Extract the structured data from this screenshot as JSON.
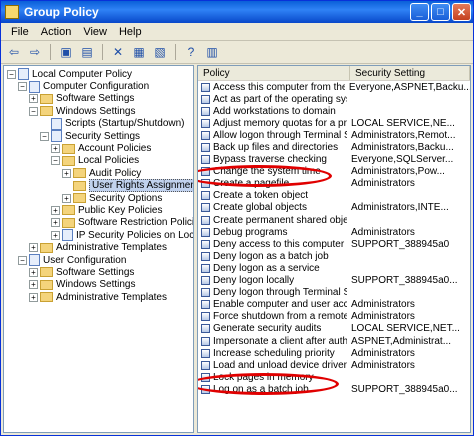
{
  "window": {
    "title": "Group Policy"
  },
  "menu": [
    "File",
    "Action",
    "View",
    "Help"
  ],
  "tree": [
    {
      "label": "Local Computer Policy",
      "indent": 0,
      "exp": "-",
      "icon": "doc"
    },
    {
      "label": "Computer Configuration",
      "indent": 1,
      "exp": "-",
      "icon": "doc"
    },
    {
      "label": "Software Settings",
      "indent": 2,
      "exp": "+",
      "icon": "folder"
    },
    {
      "label": "Windows Settings",
      "indent": 2,
      "exp": "-",
      "icon": "folder"
    },
    {
      "label": "Scripts (Startup/Shutdown)",
      "indent": 3,
      "exp": "",
      "icon": "doc"
    },
    {
      "label": "Security Settings",
      "indent": 3,
      "exp": "-",
      "icon": "doc"
    },
    {
      "label": "Account Policies",
      "indent": 4,
      "exp": "+",
      "icon": "folder"
    },
    {
      "label": "Local Policies",
      "indent": 4,
      "exp": "-",
      "icon": "folder"
    },
    {
      "label": "Audit Policy",
      "indent": 5,
      "exp": "+",
      "icon": "folder"
    },
    {
      "label": "User Rights Assignment",
      "indent": 5,
      "exp": "",
      "icon": "folder",
      "selected": true
    },
    {
      "label": "Security Options",
      "indent": 5,
      "exp": "+",
      "icon": "folder"
    },
    {
      "label": "Public Key Policies",
      "indent": 4,
      "exp": "+",
      "icon": "folder"
    },
    {
      "label": "Software Restriction Policies",
      "indent": 4,
      "exp": "+",
      "icon": "folder"
    },
    {
      "label": "IP Security Policies on Local Co",
      "indent": 4,
      "exp": "+",
      "icon": "doc"
    },
    {
      "label": "Administrative Templates",
      "indent": 2,
      "exp": "+",
      "icon": "folder"
    },
    {
      "label": "User Configuration",
      "indent": 1,
      "exp": "-",
      "icon": "doc"
    },
    {
      "label": "Software Settings",
      "indent": 2,
      "exp": "+",
      "icon": "folder"
    },
    {
      "label": "Windows Settings",
      "indent": 2,
      "exp": "+",
      "icon": "folder"
    },
    {
      "label": "Administrative Templates",
      "indent": 2,
      "exp": "+",
      "icon": "folder"
    }
  ],
  "columns": {
    "policy": "Policy",
    "setting": "Security Setting"
  },
  "rows": [
    {
      "policy": "Access this computer from the net...",
      "setting": "Everyone,ASPNET,Backu..."
    },
    {
      "policy": "Act as part of the operating system",
      "setting": ""
    },
    {
      "policy": "Add workstations to domain",
      "setting": ""
    },
    {
      "policy": "Adjust memory quotas for a process",
      "setting": "LOCAL SERVICE,NE..."
    },
    {
      "policy": "Allow logon through Terminal Serv...",
      "setting": "Administrators,Remot..."
    },
    {
      "policy": "Back up files and directories",
      "setting": "Administrators,Backu..."
    },
    {
      "policy": "Bypass traverse checking",
      "setting": "Everyone,SQLServer..."
    },
    {
      "policy": "Change the system time",
      "setting": "Administrators,Pow..."
    },
    {
      "policy": "Create a pagefile",
      "setting": "Administrators"
    },
    {
      "policy": "Create a token object",
      "setting": ""
    },
    {
      "policy": "Create global objects",
      "setting": "Administrators,INTE..."
    },
    {
      "policy": "Create permanent shared objects",
      "setting": ""
    },
    {
      "policy": "Debug programs",
      "setting": "Administrators"
    },
    {
      "policy": "Deny access to this computer from ...",
      "setting": "SUPPORT_388945a0"
    },
    {
      "policy": "Deny logon as a batch job",
      "setting": ""
    },
    {
      "policy": "Deny logon as a service",
      "setting": ""
    },
    {
      "policy": "Deny logon locally",
      "setting": "SUPPORT_388945a0..."
    },
    {
      "policy": "Deny logon through Terminal Servi...",
      "setting": ""
    },
    {
      "policy": "Enable computer and user account...",
      "setting": "Administrators"
    },
    {
      "policy": "Force shutdown from a remote sy...",
      "setting": "Administrators"
    },
    {
      "policy": "Generate security audits",
      "setting": "LOCAL SERVICE,NET..."
    },
    {
      "policy": "Impersonate a client after authen...",
      "setting": "ASPNET,Administrat..."
    },
    {
      "policy": "Increase scheduling priority",
      "setting": "Administrators"
    },
    {
      "policy": "Load and unload device drivers",
      "setting": "Administrators"
    },
    {
      "policy": "Lock pages in memory",
      "setting": ""
    },
    {
      "policy": "Log on as a batch job",
      "setting": "SUPPORT_388945a0..."
    }
  ],
  "colors": {
    "annotation": "#e00000",
    "selection": "#c1d2ee"
  }
}
